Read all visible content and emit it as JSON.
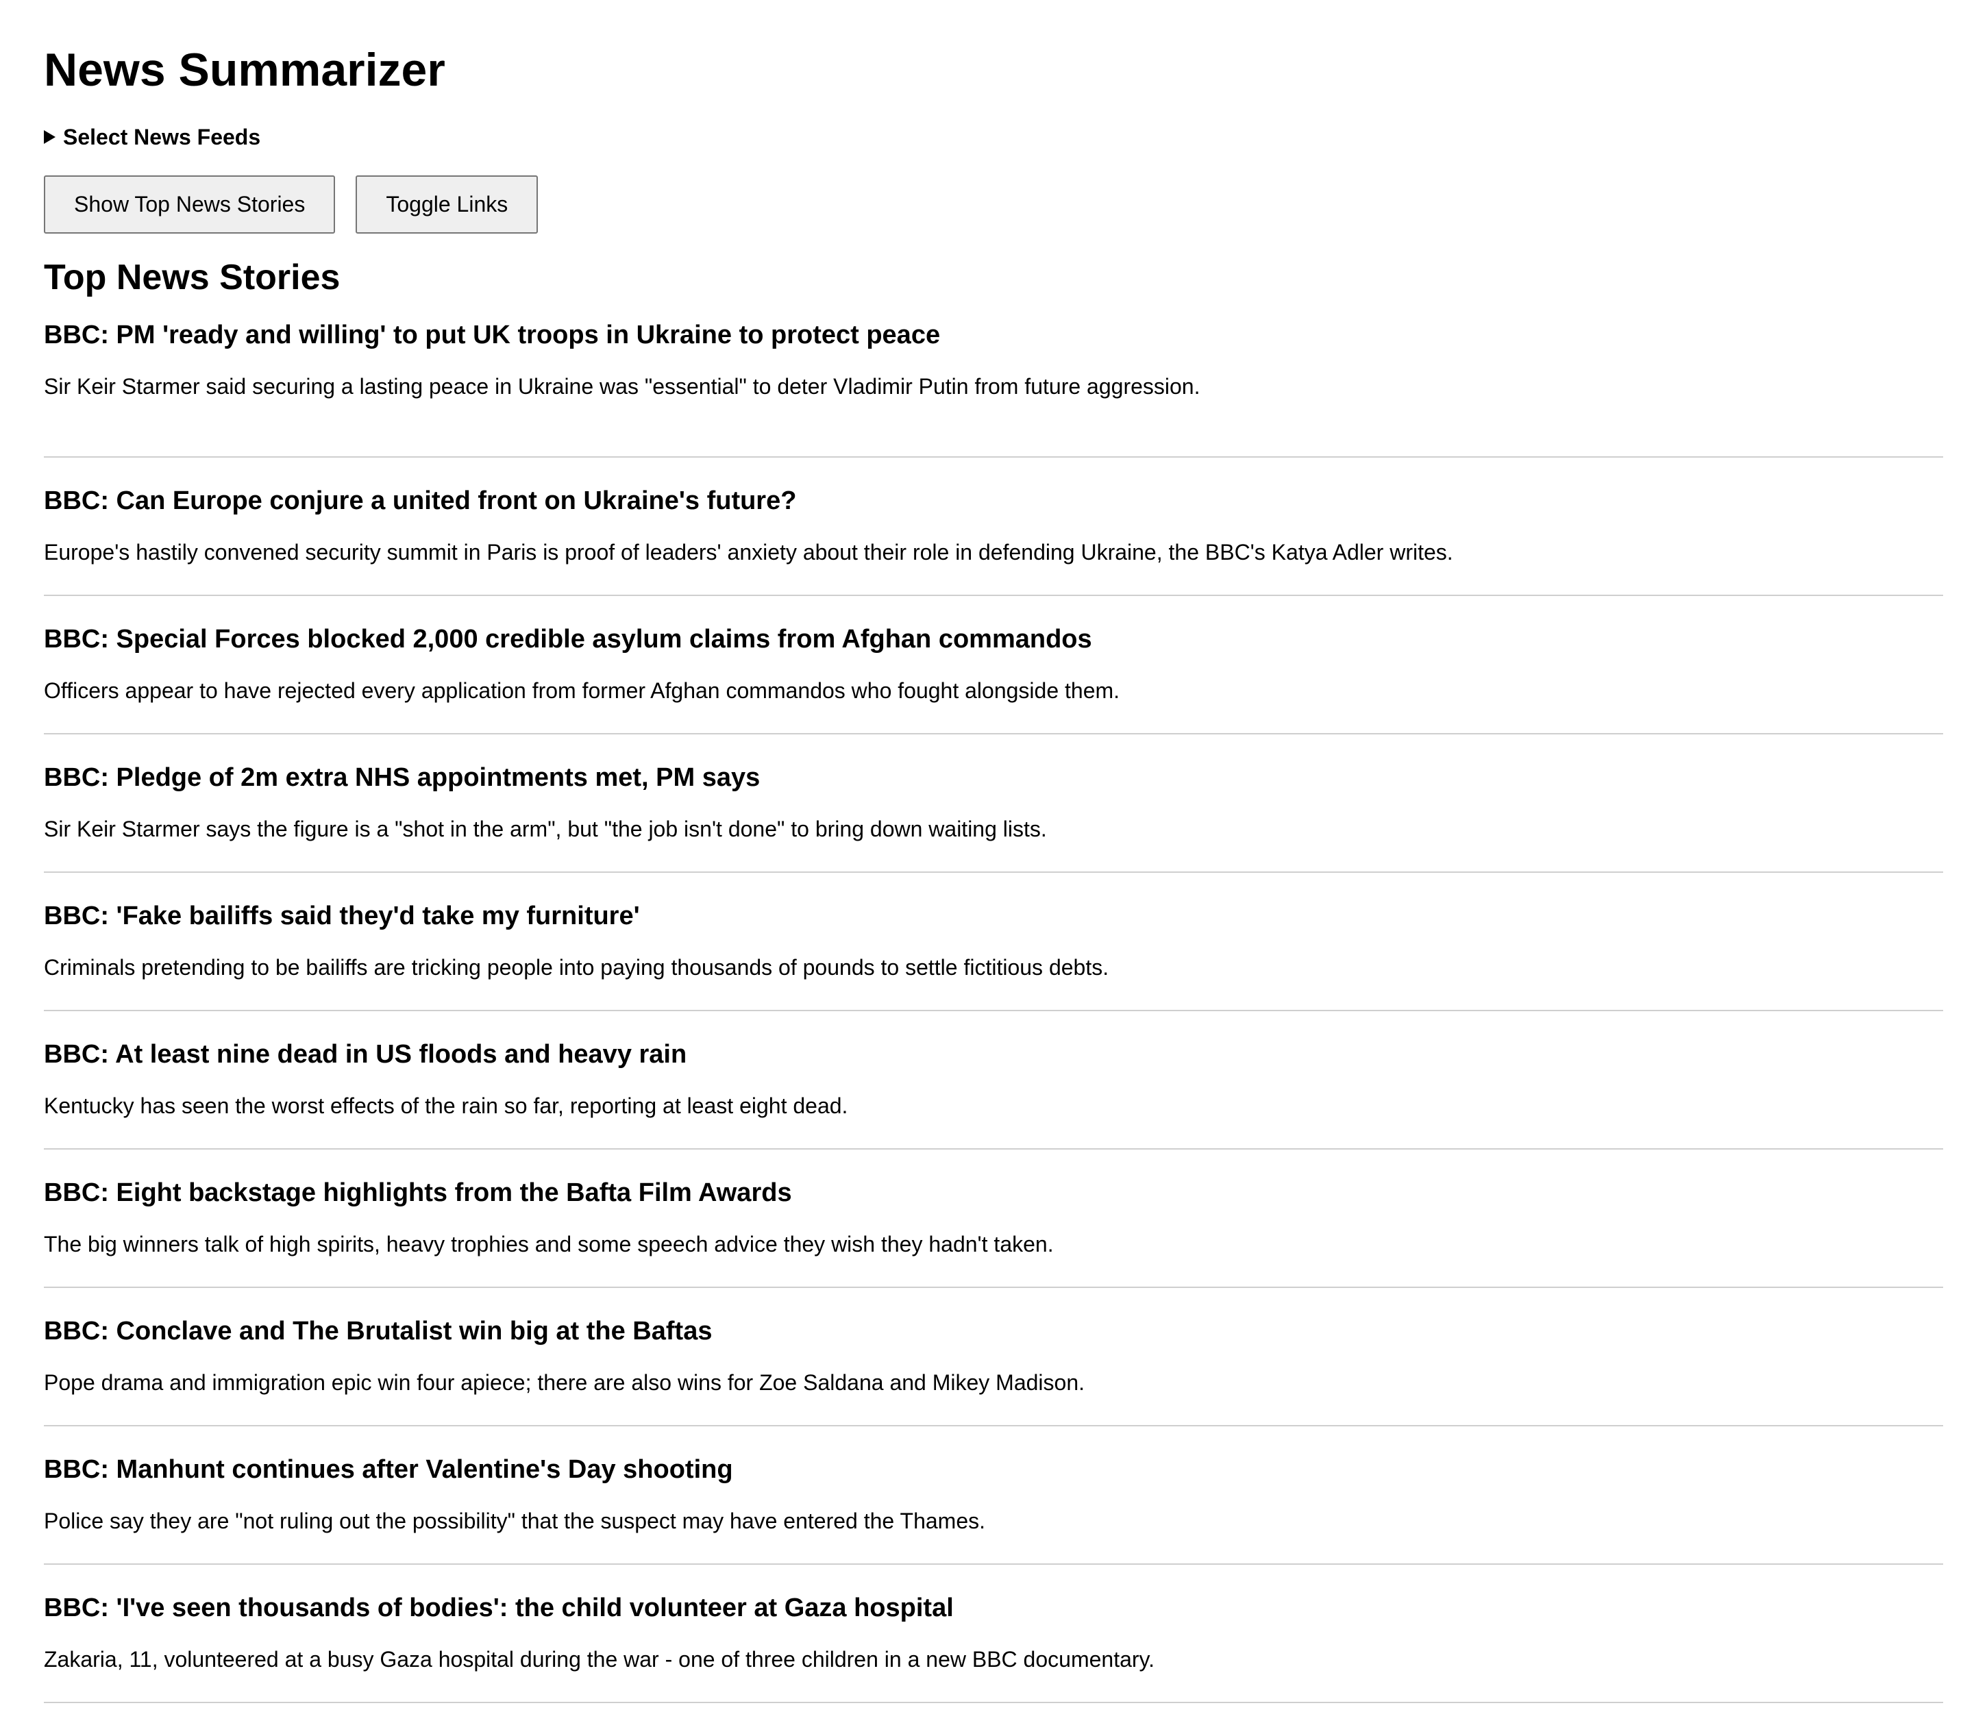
{
  "app": {
    "title": "News Summarizer"
  },
  "feeds": {
    "label": "Select News Feeds",
    "expanded": false
  },
  "toolbar": {
    "show_top_label": "Show Top News Stories",
    "toggle_links_label": "Toggle Links"
  },
  "main": {
    "section_title": "Top News Stories",
    "stories": [
      {
        "title": "BBC: PM 'ready and willing' to put UK troops in Ukraine to protect peace",
        "summary": "Sir Keir Starmer said securing a lasting peace in Ukraine was \"essential\" to deter Vladimir Putin from future aggression."
      },
      {
        "title": "BBC: Can Europe conjure a united front on Ukraine's future?",
        "summary": "Europe's hastily convened security summit in Paris is proof of leaders' anxiety about their role in defending Ukraine, the BBC's Katya Adler writes."
      },
      {
        "title": "BBC: Special Forces blocked 2,000 credible asylum claims from Afghan commandos",
        "summary": "Officers appear to have rejected every application from former Afghan commandos who fought alongside them."
      },
      {
        "title": "BBC: Pledge of 2m extra NHS appointments met, PM says",
        "summary": "Sir Keir Starmer says the figure is a \"shot in the arm\", but \"the job isn't done\" to bring down waiting lists."
      },
      {
        "title": "BBC: 'Fake bailiffs said they'd take my furniture'",
        "summary": "Criminals pretending to be bailiffs are tricking people into paying thousands of pounds to settle fictitious debts."
      },
      {
        "title": "BBC: At least nine dead in US floods and heavy rain",
        "summary": "Kentucky has seen the worst effects of the rain so far, reporting at least eight dead."
      },
      {
        "title": "BBC: Eight backstage highlights from the Bafta Film Awards",
        "summary": "The big winners talk of high spirits, heavy trophies and some speech advice they wish they hadn't taken."
      },
      {
        "title": "BBC: Conclave and The Brutalist win big at the Baftas",
        "summary": "Pope drama and immigration epic win four apiece; there are also wins for Zoe Saldana and Mikey Madison."
      },
      {
        "title": "BBC: Manhunt continues after Valentine's Day shooting",
        "summary": "Police say they are \"not ruling out the possibility\" that the suspect may have entered the Thames."
      },
      {
        "title": "BBC: 'I've seen thousands of bodies': the child volunteer at Gaza hospital",
        "summary": "Zakaria, 11, volunteered at a busy Gaza hospital during the war - one of three children in a new BBC documentary."
      }
    ]
  }
}
